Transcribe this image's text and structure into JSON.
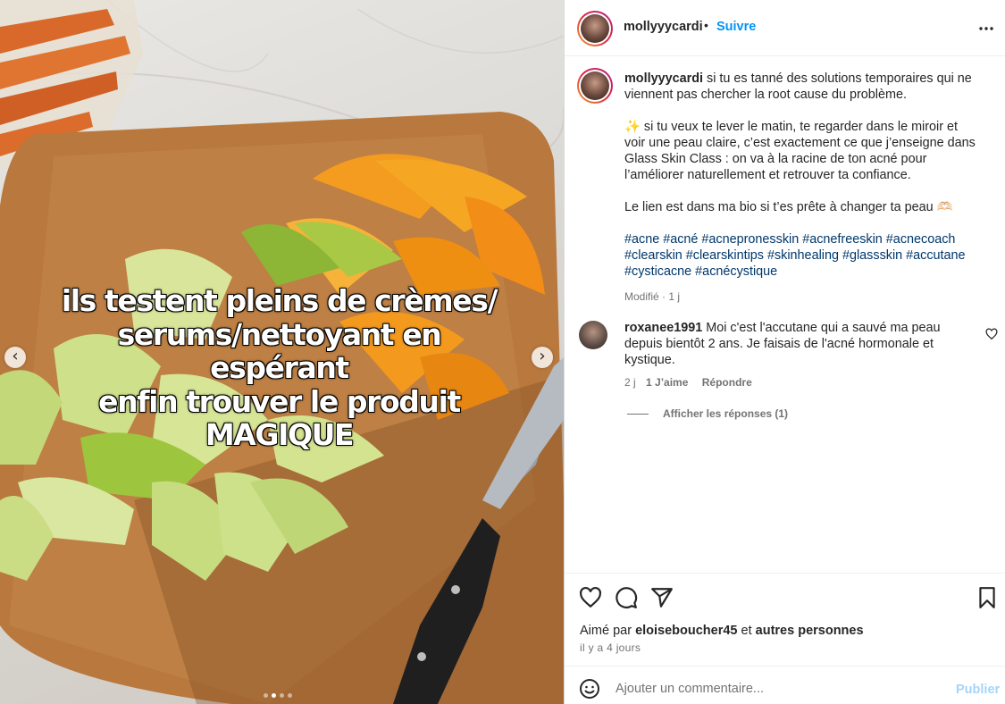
{
  "post": {
    "author": "mollyyycardi",
    "separator": "•",
    "follow_label": "Suivre",
    "more_icon": "more-horizontal-icon",
    "media": {
      "overlay_lines": [
        "ils testent pleins de crèmes/",
        "serums/nettoyant en espérant",
        "enfin trouver le produit",
        "MAGIQUE"
      ],
      "prev_label": "‹",
      "next_label": "›",
      "slides_count": 4,
      "active_slide": 2
    },
    "caption": {
      "username": "mollyyycardi",
      "p1": "si tu es tanné des solutions temporaires qui ne viennent pas chercher la root cause du problème.",
      "p2": "✨ si tu veux te lever le matin, te regarder dans le miroir et voir une peau claire, c’est exactement ce que j’enseigne dans Glass Skin Class : on va à la racine de ton acné pour l’améliorer naturellement et retrouver ta confiance.",
      "p3": "Le lien est dans ma bio si t’es prête à changer ta peau 🫶🏻",
      "hashtags": "#acne #acné #acnepronesskin #acnefreeskin #acnecoach #clearskin #clearskintips #skinhealing #glassskin #accutane #cysticacne #acnécystique",
      "meta": "Modifié · 1 j"
    },
    "comment": {
      "username": "roxanee1991",
      "text": "Moi c'est l'accutane qui a sauvé ma peau depuis bientôt 2 ans. Je faisais de l'acné hormonale et kystique.",
      "age": "2 j",
      "likes": "1 J’aime",
      "reply_label": "Répondre",
      "view_replies": "Afficher les réponses (1)"
    },
    "actions": {
      "like_icon": "heart-icon",
      "comment_icon": "comment-bubble-icon",
      "share_icon": "paper-plane-icon",
      "save_icon": "bookmark-icon",
      "liked_prefix": "Aimé par",
      "liked_user": "eloiseboucher45",
      "liked_middle": "et",
      "liked_suffix": "autres personnes",
      "time_ago": "il y a 4 jours"
    },
    "composer": {
      "placeholder": "Ajouter un commentaire...",
      "publish_label": "Publier",
      "emoji_icon": "smiley-icon"
    }
  },
  "colors": {
    "link_blue": "#0095f6",
    "hashtag_blue": "#00376b",
    "muted_gray": "#737373",
    "publish_disabled": "#a3d5fb"
  }
}
